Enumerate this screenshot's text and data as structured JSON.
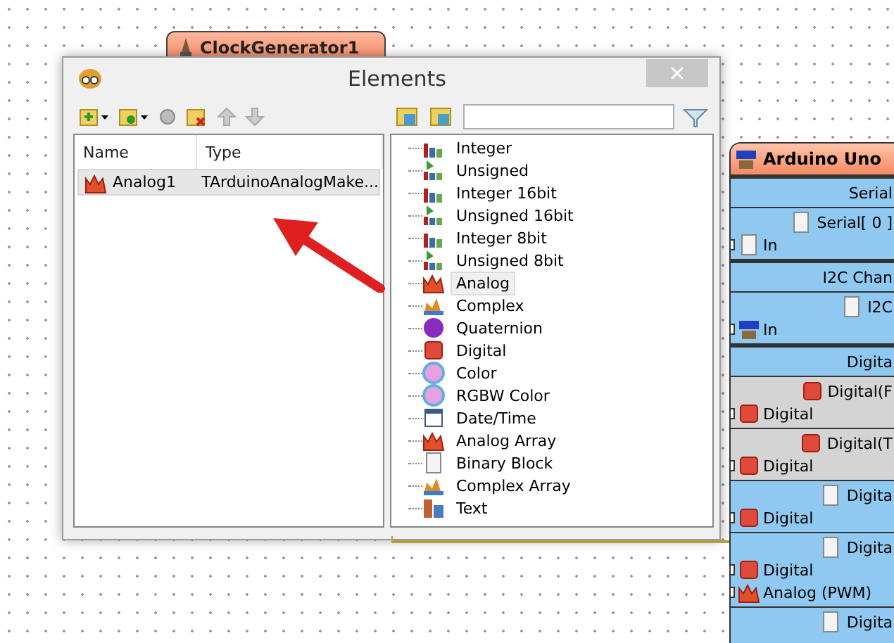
{
  "canvas_component": {
    "title": "ClockGenerator1"
  },
  "dialog": {
    "title": "Elements",
    "list": {
      "columns": [
        "Name",
        "Type"
      ],
      "rows": [
        {
          "name": "Analog1",
          "type": "TArduinoAnalogMake...",
          "selected": true
        }
      ]
    },
    "palette": {
      "items": [
        {
          "label": "Integer",
          "kind": "int",
          "selected": false
        },
        {
          "label": "Unsigned",
          "kind": "uint",
          "selected": false
        },
        {
          "label": "Integer 16bit",
          "kind": "int",
          "selected": false
        },
        {
          "label": "Unsigned 16bit",
          "kind": "uint",
          "selected": false
        },
        {
          "label": "Integer 8bit",
          "kind": "int",
          "selected": false
        },
        {
          "label": "Unsigned 8bit",
          "kind": "uint",
          "selected": false
        },
        {
          "label": "Analog",
          "kind": "analog",
          "selected": true
        },
        {
          "label": "Complex",
          "kind": "complex",
          "selected": false
        },
        {
          "label": "Quaternion",
          "kind": "quaternion",
          "selected": false
        },
        {
          "label": "Digital",
          "kind": "digital",
          "selected": false
        },
        {
          "label": "Color",
          "kind": "color",
          "selected": false
        },
        {
          "label": "RGBW Color",
          "kind": "color",
          "selected": false
        },
        {
          "label": "Date/Time",
          "kind": "datetime",
          "selected": false
        },
        {
          "label": "Analog Array",
          "kind": "analog",
          "selected": false
        },
        {
          "label": "Binary Block",
          "kind": "binary",
          "selected": false
        },
        {
          "label": "Complex Array",
          "kind": "complex",
          "selected": false
        },
        {
          "label": "Text",
          "kind": "text",
          "selected": false
        }
      ]
    }
  },
  "arduino": {
    "title": "Arduino Uno",
    "sections": [
      {
        "header": "Serial",
        "groups": [
          {
            "label": "Serial[ 0 ]",
            "disabled": false,
            "pins": [
              {
                "label": "In",
                "kind": "binary"
              }
            ]
          }
        ]
      },
      {
        "header": "I2C Chan",
        "groups": [
          {
            "label": "I2C",
            "disabled": false,
            "pins": [
              {
                "label": "In",
                "kind": "i2c"
              }
            ]
          }
        ]
      },
      {
        "header": "Digita",
        "groups": [
          {
            "label": "Digital(F",
            "disabled": true,
            "pins": [
              {
                "label": "Digital",
                "kind": "digital"
              }
            ]
          },
          {
            "label": "Digital(T",
            "disabled": true,
            "pins": [
              {
                "label": "Digital",
                "kind": "digital"
              }
            ]
          },
          {
            "label": "Digita",
            "disabled": false,
            "pins": [
              {
                "label": "Digital",
                "kind": "digital"
              }
            ]
          },
          {
            "label": "Digita",
            "disabled": false,
            "pins": [
              {
                "label": "Digital",
                "kind": "digital"
              },
              {
                "label": "Analog (PWM)",
                "kind": "analog"
              }
            ]
          },
          {
            "label": "Digita",
            "disabled": false
          }
        ]
      }
    ]
  }
}
